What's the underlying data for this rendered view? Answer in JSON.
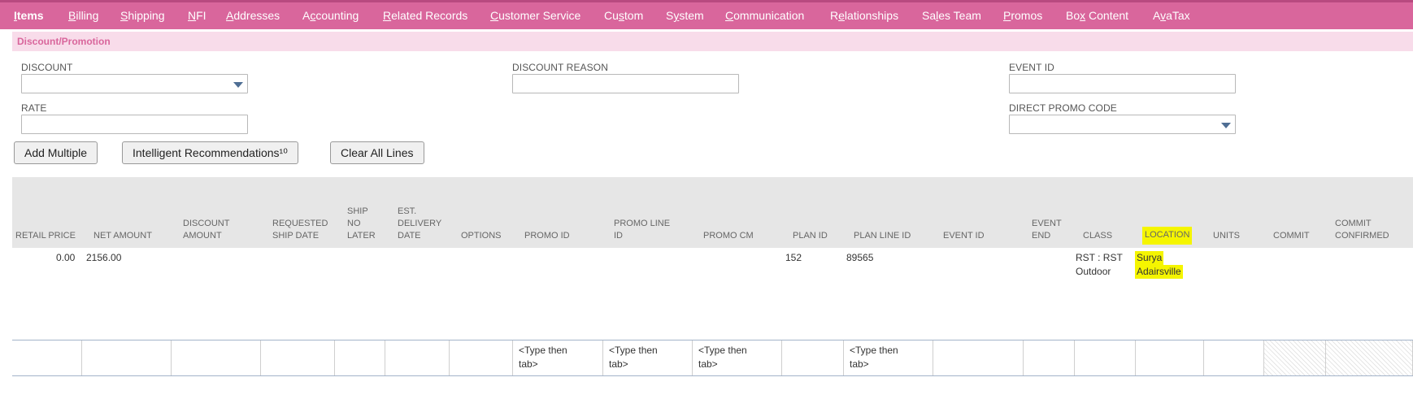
{
  "tabs": [
    {
      "label": "Items",
      "accesskey": "I",
      "rest": "tems",
      "active": true
    },
    {
      "label": "Billing",
      "accesskey": "B",
      "rest": "illing"
    },
    {
      "label": "Shipping",
      "accesskey": "S",
      "rest": "hipping"
    },
    {
      "label": "NFI",
      "accesskey": "N",
      "rest": "FI"
    },
    {
      "label": "Addresses",
      "accesskey": "A",
      "rest": "ddresses"
    },
    {
      "label": "Accounting",
      "pre": "A",
      "accesskey": "c",
      "rest": "counting"
    },
    {
      "label": "Related Records",
      "accesskey": "R",
      "rest": "elated Records"
    },
    {
      "label": "Customer Service",
      "accesskey": "C",
      "rest": "ustomer Service"
    },
    {
      "label": "Custom",
      "pre": "Cu",
      "accesskey": "s",
      "rest": "tom"
    },
    {
      "label": "System",
      "pre": "S",
      "accesskey": "y",
      "rest": "stem"
    },
    {
      "label": "Communication",
      "accesskey": "C",
      "rest": "ommunication"
    },
    {
      "label": "Relationships",
      "pre": "R",
      "accesskey": "e",
      "rest": "lationships"
    },
    {
      "label": "Sales Team",
      "pre": "Sa",
      "accesskey": "l",
      "rest": "es Team"
    },
    {
      "label": "Promos",
      "accesskey": "P",
      "rest": "romos"
    },
    {
      "label": "Box Content",
      "pre": "Bo",
      "accesskey": "x",
      "rest": " Content"
    },
    {
      "label": "AvaTax",
      "pre": "A",
      "accesskey": "v",
      "rest": "aTax"
    }
  ],
  "section": {
    "title": "Discount/Promotion"
  },
  "fields": {
    "discount": {
      "label": "DISCOUNT",
      "value": ""
    },
    "discount_reason": {
      "label": "DISCOUNT REASON",
      "value": ""
    },
    "event_id": {
      "label": "EVENT ID",
      "value": ""
    },
    "rate": {
      "label": "RATE",
      "value": ""
    },
    "direct_promo_code": {
      "label": "DIRECT PROMO CODE",
      "value": ""
    }
  },
  "buttons": {
    "add_multiple": "Add Multiple",
    "intelligent_recommendations": "Intelligent Recommendations¹⁰",
    "clear_all_lines": "Clear All Lines"
  },
  "columns": [
    {
      "key": "retail_price",
      "lines": [
        "RETAIL PRICE"
      ]
    },
    {
      "key": "net_amount",
      "lines": [
        "NET AMOUNT"
      ]
    },
    {
      "key": "discount_amount",
      "lines": [
        "DISCOUNT",
        "AMOUNT"
      ]
    },
    {
      "key": "requested_ship_date",
      "lines": [
        "REQUESTED",
        "SHIP DATE"
      ]
    },
    {
      "key": "ship_no_later",
      "lines": [
        "SHIP",
        "NO",
        "LATER"
      ]
    },
    {
      "key": "est_delivery_date",
      "lines": [
        "EST.",
        "DELIVERY",
        "DATE"
      ]
    },
    {
      "key": "options",
      "lines": [
        "OPTIONS"
      ]
    },
    {
      "key": "promo_id",
      "lines": [
        "PROMO ID"
      ]
    },
    {
      "key": "promo_line_id",
      "lines": [
        "PROMO LINE",
        "ID"
      ]
    },
    {
      "key": "promo_cm",
      "lines": [
        "PROMO CM"
      ]
    },
    {
      "key": "plan_id",
      "lines": [
        "PLAN ID"
      ]
    },
    {
      "key": "plan_line_id",
      "lines": [
        "PLAN LINE ID"
      ]
    },
    {
      "key": "event_id",
      "lines": [
        "EVENT ID"
      ]
    },
    {
      "key": "event_end",
      "lines": [
        "EVENT",
        "END"
      ]
    },
    {
      "key": "class",
      "lines": [
        "CLASS"
      ]
    },
    {
      "key": "location",
      "lines": [
        "LOCATION"
      ],
      "highlighted": true
    },
    {
      "key": "units",
      "lines": [
        "UNITS"
      ]
    },
    {
      "key": "commit",
      "lines": [
        "COMMIT"
      ]
    },
    {
      "key": "commit_confirmed",
      "lines": [
        "COMMIT",
        "CONFIRMED"
      ]
    }
  ],
  "rows": [
    {
      "retail_price": "0.00",
      "net_amount": "2156.00",
      "plan_id": "152",
      "plan_line_id": "89565",
      "class": [
        "RST : RST",
        "Outdoor"
      ],
      "location": [
        "Surya",
        "Adairsville"
      ]
    }
  ],
  "entry_row": {
    "promo_id": [
      "<Type then",
      "tab>"
    ],
    "promo_line_id": [
      "<Type then",
      "tab>"
    ],
    "promo_cm": [
      "<Type then",
      "tab>"
    ],
    "plan_line_id": [
      "<Type then",
      "tab>"
    ]
  },
  "colors": {
    "tab_bar": "#d9669c",
    "section_bg": "#f8dcea",
    "highlight": "#f5f500",
    "caret": "#4f6e94"
  }
}
